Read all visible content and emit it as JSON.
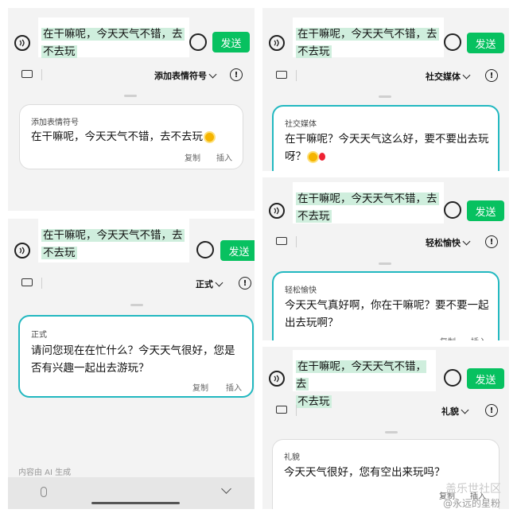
{
  "input": {
    "line1": "在干嘛呢，今天天气不错，去",
    "line2": "不去玩",
    "send_label": "发送"
  },
  "panels": {
    "p1": {
      "mode": "添加表情符号",
      "card_label": "添加表情符号",
      "line1": "在干嘛呢，今天天气不错，去不去玩",
      "emoji": "sun-emoji"
    },
    "p2": {
      "mode": "正式",
      "card_label": "正式",
      "line1": "请问您现在在忙什么？今天天气很好，您是",
      "line2": "否有兴趣一起出去游玩？"
    },
    "p3": {
      "mode": "社交媒体",
      "card_label": "社交媒体",
      "line1": "在干嘛呢？今天天气这么好，要不要出去玩",
      "line2": "呀？"
    },
    "p4": {
      "mode": "轻松愉快",
      "card_label": "轻松愉快",
      "line1": "今天天气真好啊，你在干嘛呢？要不要一起",
      "line2": "出去玩啊？"
    },
    "p5": {
      "mode": "礼貌",
      "card_label": "礼貌",
      "line1": "今天天气很好，您有空出来玩吗？"
    }
  },
  "actions": {
    "copy": "复制",
    "insert": "插入"
  },
  "footer": {
    "ai_note": "内容由 AI 生成"
  },
  "watermark": {
    "line1": "盖乐世社区",
    "line2": "@永远的星粉"
  },
  "colors": {
    "send": "#07c160",
    "highlight": "#cfeedd",
    "card_border": "#22b8c0",
    "panel_bg": "#f3f3f3"
  }
}
